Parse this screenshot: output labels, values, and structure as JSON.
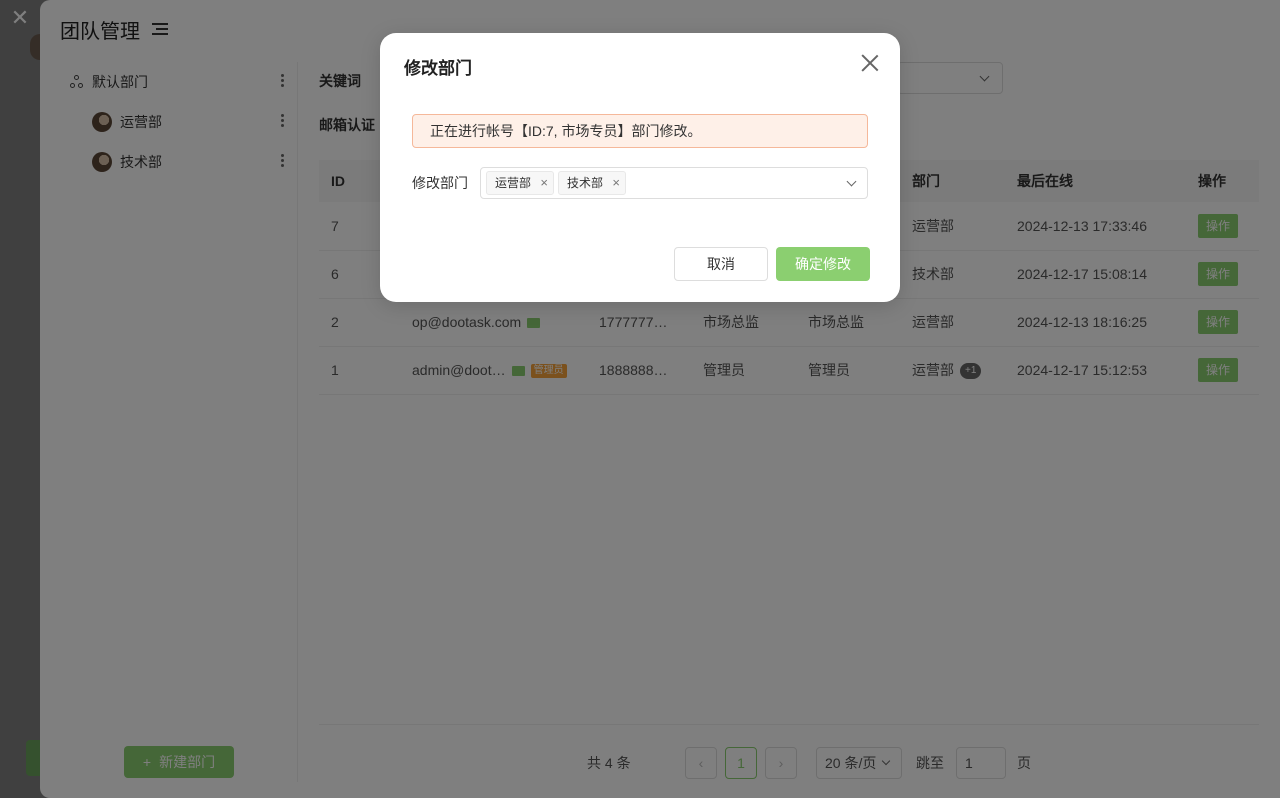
{
  "outer": {
    "close_glyph": "✕"
  },
  "drawer": {
    "title": "团队管理",
    "menu_icon": "list-icon"
  },
  "sidebar": {
    "items": [
      {
        "label": "默认部门",
        "icon": "tree-icon"
      },
      {
        "label": "运营部",
        "icon": "avatar"
      },
      {
        "label": "技术部",
        "icon": "avatar"
      }
    ],
    "new_dept_label": "新建部门",
    "new_dept_icon": "+"
  },
  "filters": {
    "keyword_label": "关键词",
    "email_label": "邮箱认证"
  },
  "table": {
    "headers": [
      "ID",
      "部门",
      "最后在线",
      "操作"
    ],
    "rows": [
      {
        "id": "7",
        "email": "",
        "phone": "",
        "role": "",
        "title": "",
        "dept": "运营部",
        "dept_extra": "",
        "last_online": "2024-12-13 17:33:46",
        "action": "操作"
      },
      {
        "id": "6",
        "email": "",
        "phone": "",
        "role": "",
        "title": "",
        "dept": "技术部",
        "dept_extra": "",
        "last_online": "2024-12-17 15:08:14",
        "action": "操作"
      },
      {
        "id": "2",
        "email": "op@dootask.com",
        "phone": "1777777…",
        "role": "市场总监",
        "title": "市场总监",
        "dept": "运营部",
        "dept_extra": "",
        "last_online": "2024-12-13 18:16:25",
        "action": "操作"
      },
      {
        "id": "1",
        "email": "admin@doot…",
        "admin_tag": "管理员",
        "phone": "1888888…",
        "role": "管理员",
        "title": "管理员",
        "dept": "运营部",
        "dept_extra": "+1",
        "last_online": "2024-12-17 15:12:53",
        "action": "操作"
      }
    ]
  },
  "pager": {
    "total": "共 4 条",
    "prev": "‹",
    "current": "1",
    "next": "›",
    "page_size": "20 条/页",
    "jump_label": "跳至",
    "jump_value": "1",
    "page_unit": "页"
  },
  "modal": {
    "title": "修改部门",
    "alert": "正在进行帐号【ID:7, 市场专员】部门修改。",
    "field_label": "修改部门",
    "tags": [
      "运营部",
      "技术部"
    ],
    "tag_remove": "×",
    "cancel_label": "取消",
    "confirm_label": "确定修改"
  },
  "colors": {
    "accent": "#8bcf70",
    "alert_bg": "#fef0e8",
    "alert_border": "#f5b89a"
  }
}
